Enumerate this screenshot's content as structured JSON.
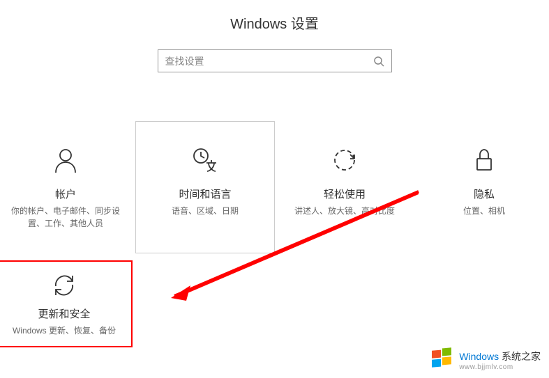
{
  "header": {
    "title": "Windows 设置"
  },
  "search": {
    "placeholder": "查找设置"
  },
  "tiles": {
    "accounts": {
      "title": "帐户",
      "desc": "你的帐户、电子邮件、同步设置、工作、其他人员"
    },
    "timeLanguage": {
      "title": "时间和语言",
      "desc": "语音、区域、日期"
    },
    "easeOfAccess": {
      "title": "轻松使用",
      "desc": "讲述人、放大镜、高对比度"
    },
    "privacy": {
      "title": "隐私",
      "desc": "位置、相机"
    },
    "updateSecurity": {
      "title": "更新和安全",
      "desc": "Windows 更新、恢复、备份"
    }
  },
  "watermark": {
    "brand": "Windows",
    "suffix": " 系统之家",
    "url": "www.bjjmlv.com"
  }
}
